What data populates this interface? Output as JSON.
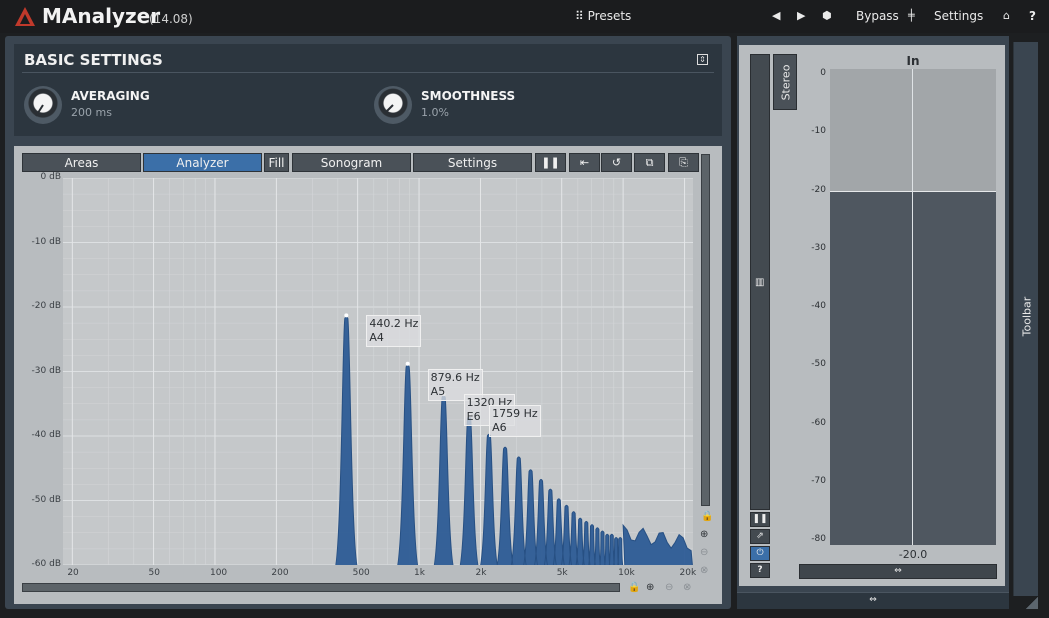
{
  "app": {
    "title": "MAnalyzer",
    "version": "(14.08)"
  },
  "topbar": {
    "presets_label": "Presets",
    "bypass_label": "Bypass",
    "settings_label": "Settings",
    "help_label": "?"
  },
  "basic_settings": {
    "title": "BASIC SETTINGS",
    "averaging": {
      "label": "AVERAGING",
      "value": "200 ms"
    },
    "smoothness": {
      "label": "SMOOTHNESS",
      "value": "1.0%"
    }
  },
  "analyzer_tabs": {
    "areas": "Areas",
    "analyzer": "Analyzer",
    "fill": "Fill",
    "sonogram": "Sonogram",
    "settings": "Settings"
  },
  "analyzer_icons": [
    "pause-icon",
    "reset-icon",
    "undo-icon",
    "copy-icon",
    "paste-icon"
  ],
  "chart_data": {
    "type": "area",
    "title": "",
    "xlabel": "",
    "ylabel": "",
    "x_scale": "log",
    "xlim": [
      18,
      22000
    ],
    "ylim": [
      -60,
      0
    ],
    "y_ticks": [
      "0 dB",
      "-10 dB",
      "-20 dB",
      "-30 dB",
      "-40 dB",
      "-50 dB",
      "-60 dB"
    ],
    "x_ticks": [
      "20",
      "50",
      "100",
      "200",
      "500",
      "1k",
      "2k",
      "5k",
      "10k",
      "20k"
    ],
    "x_tick_values": [
      20,
      50,
      100,
      200,
      500,
      1000,
      2000,
      5000,
      10000,
      20000
    ],
    "grid": true,
    "fill_color": "#2e5c96",
    "peaks": [
      {
        "freq": 440.2,
        "db": -21.3
      },
      {
        "freq": 879.6,
        "db": -28.8
      },
      {
        "freq": 1320,
        "db": -33.5
      },
      {
        "freq": 1759,
        "db": -36.8
      },
      {
        "freq": 2200,
        "db": -39.5
      },
      {
        "freq": 2640,
        "db": -41.5
      },
      {
        "freq": 3080,
        "db": -43.0
      },
      {
        "freq": 3520,
        "db": -45.0
      },
      {
        "freq": 3960,
        "db": -46.5
      },
      {
        "freq": 4400,
        "db": -48.0
      },
      {
        "freq": 4840,
        "db": -49.5
      },
      {
        "freq": 5280,
        "db": -50.5
      },
      {
        "freq": 5720,
        "db": -51.5
      },
      {
        "freq": 6160,
        "db": -52.5
      },
      {
        "freq": 6600,
        "db": -53.0
      },
      {
        "freq": 7040,
        "db": -53.5
      },
      {
        "freq": 7480,
        "db": -54.0
      },
      {
        "freq": 7920,
        "db": -54.5
      },
      {
        "freq": 8360,
        "db": -55.0
      },
      {
        "freq": 8800,
        "db": -55.0
      },
      {
        "freq": 9240,
        "db": -55.5
      },
      {
        "freq": 9680,
        "db": -55.5
      }
    ],
    "annotations": [
      {
        "freq_label": "440.2 Hz",
        "note": "A4"
      },
      {
        "freq_label": "879.6 Hz",
        "note": "A5"
      },
      {
        "freq_label": "1320 Hz",
        "note": "E6"
      },
      {
        "freq_label": "1759 Hz",
        "note": "A6"
      }
    ]
  },
  "meter": {
    "title": "In",
    "stereo_label": "Stereo",
    "scale": [
      "0",
      "-10",
      "-20",
      "-30",
      "-40",
      "-50",
      "-60",
      "-70",
      "-80"
    ],
    "level_db": -20.0,
    "value_label": "-20.0",
    "range": [
      -80,
      0
    ]
  },
  "toolbar": {
    "label": "Toolbar"
  },
  "colors": {
    "accent": "#3b6fa8",
    "spectrum": "#2e5c96",
    "panel": "#3a4550"
  }
}
